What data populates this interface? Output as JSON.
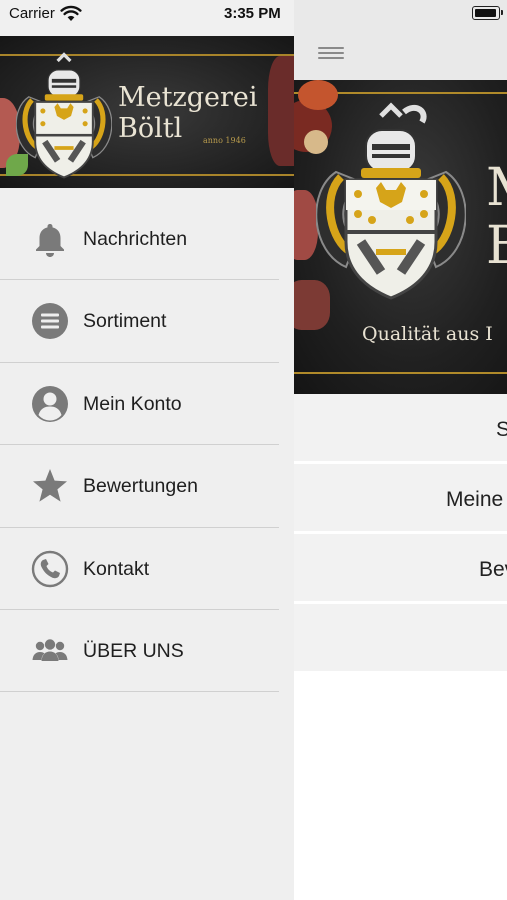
{
  "status_bar": {
    "carrier": "Carrier",
    "time": "3:35 PM"
  },
  "drawer": {
    "banner": {
      "title_line1": "Metzgerei",
      "title_line2": "Böltl",
      "since": "anno 1946"
    },
    "menu": [
      {
        "label": "Nachrichten",
        "icon": "bell-icon"
      },
      {
        "label": "Sortiment",
        "icon": "list-icon"
      },
      {
        "label": "Mein Konto",
        "icon": "account-icon"
      },
      {
        "label": "Bewertungen",
        "icon": "star-icon"
      },
      {
        "label": "Kontakt",
        "icon": "phone-icon"
      },
      {
        "label": "ÜBER UNS",
        "icon": "group-icon"
      }
    ]
  },
  "main": {
    "hero": {
      "title_line1": "M",
      "title_line2": "B",
      "tagline": "Qualität aus I"
    },
    "list": [
      {
        "label": "S"
      },
      {
        "label": "Meine"
      },
      {
        "label": "Bev"
      },
      {
        "label": ""
      }
    ]
  },
  "colors": {
    "drawer_bg": "#efefef",
    "icon_gray": "#7a7a7a",
    "banner_gold": "#b08a2a",
    "banner_dark": "#222222"
  }
}
